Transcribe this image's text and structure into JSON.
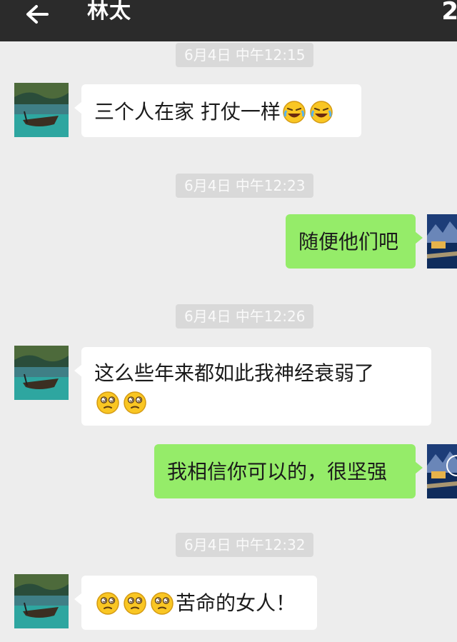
{
  "header": {
    "title": "林太",
    "back_icon": "arrow-left-icon",
    "corner_text": "2"
  },
  "messages": [
    {
      "timestamp": "6月4日 中午12:15"
    },
    {
      "sender": "other",
      "text": "三个人在家 打仗一样",
      "emojis": [
        "laugh-cry-emoji",
        "laugh-cry-emoji"
      ]
    },
    {
      "timestamp": "6月4日 中午12:23"
    },
    {
      "sender": "me",
      "text": "随便他们吧"
    },
    {
      "timestamp": "6月4日 中午12:26"
    },
    {
      "sender": "other",
      "text": "这么些年来都如此我神经衰弱了",
      "emojis": [
        "dizzy-emoji",
        "dizzy-emoji"
      ]
    },
    {
      "sender": "me",
      "text": "我相信你可以的，很坚强"
    },
    {
      "timestamp": "6月4日 中午12:32"
    },
    {
      "sender": "other",
      "text": "苦命的女人！",
      "emojis_prefix": [
        "dizzy-emoji",
        "dizzy-emoji",
        "dizzy-emoji"
      ]
    }
  ],
  "colors": {
    "header_bg": "#2b2b2b",
    "chat_bg": "#ededed",
    "my_bubble": "#95ec69",
    "other_bubble": "#ffffff",
    "timestamp_bg": "#d9d9d9"
  }
}
